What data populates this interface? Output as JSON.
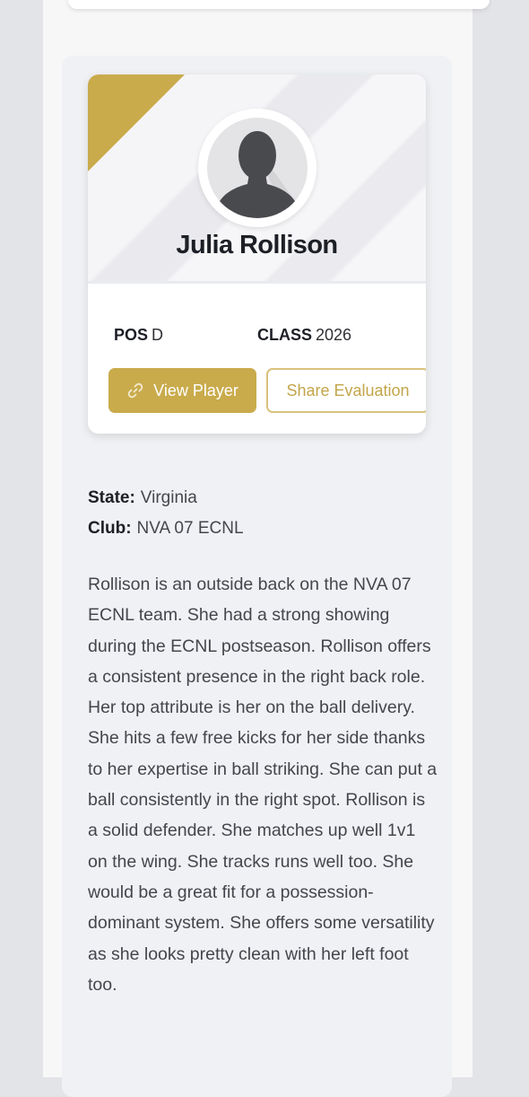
{
  "player": {
    "name": "Julia Rollison",
    "position_label": "POS",
    "position_value": "D",
    "class_label": "CLASS",
    "class_value": "2026"
  },
  "actions": {
    "view_player_label": "View Player",
    "share_evaluation_label": "Share Evaluation"
  },
  "details": {
    "state_label": "State:",
    "state_value": "Virginia",
    "club_label": "Club:",
    "club_value": "NVA 07 ECNL"
  },
  "evaluation": {
    "text": "Rollison is an outside back on the NVA 07 ECNL team. She had a strong showing during the ECNL postseason. Rollison offers a consistent presence in the right back role. Her top attribute is her on the ball delivery. She hits a few free kicks for her side thanks to her expertise in ball striking. She can put a ball consistently in the right spot. Rollison is a solid defender. She matches up well 1v1 on the wing. She tracks runs well too. She would be a great fit for a possession-dominant system. She offers some versatility as she looks pretty clean with her left foot too."
  },
  "icons": {
    "view_player_icon": "link-icon",
    "avatar_icon": "person-silhouette-icon"
  },
  "colors": {
    "accent_gold": "#c9ab4c",
    "text_dark": "#1d1f26",
    "text_body": "#44464d"
  }
}
